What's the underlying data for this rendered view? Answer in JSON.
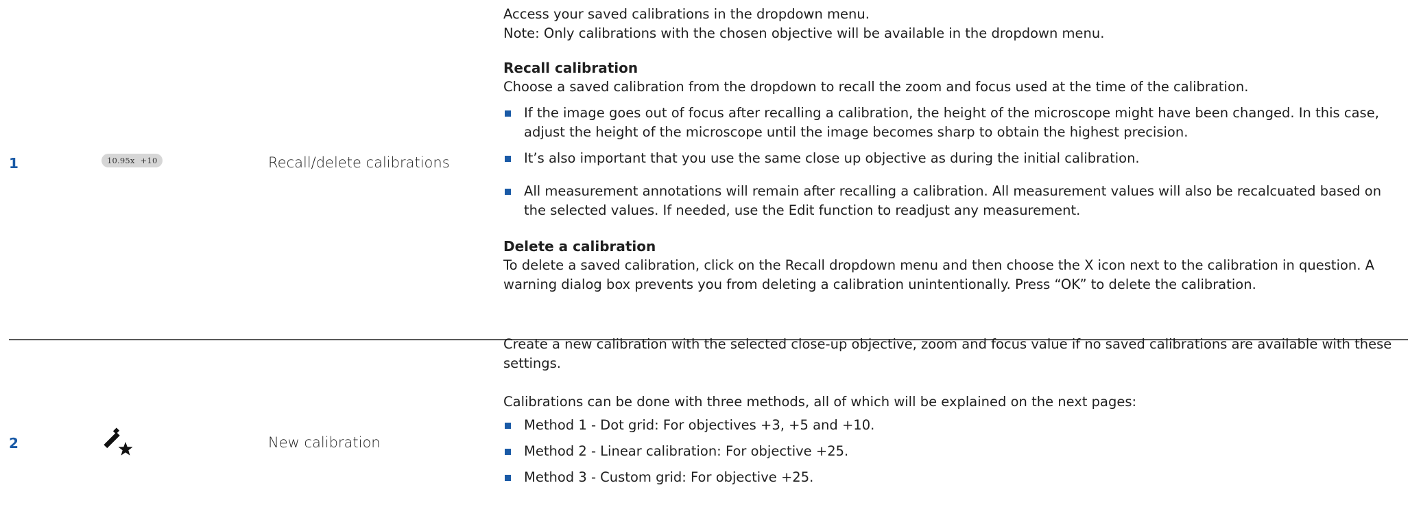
{
  "rows": [
    {
      "number": "1",
      "icon": {
        "name": "zoom-objective-pill",
        "zoom": "10.95x",
        "objective": "+10"
      },
      "function": "Recall/delete calibrations",
      "intro": [
        "Access your saved calibrations in the dropdown menu.",
        "Note: Only calibrations with the chosen objective will be available in the dropdown menu."
      ],
      "recall_heading": "Recall calibration",
      "recall_text": "Choose a saved calibration from the dropdown to recall the zoom and focus used at the time of the calibration.",
      "recall_bullets": [
        "If the image goes out of focus after recalling a calibration, the height of the microscope might have been changed. In this case, adjust the height of the microscope until the image becomes sharp to obtain the highest precision.",
        "It’s also important that you use the same close up objective as during the initial calibration.",
        "All measurement annotations will remain after recalling a calibration. All measurement values will also be recalcuated based on the selected values. If needed, use the Edit function to readjust any measurement."
      ],
      "delete_heading": "Delete a calibration",
      "delete_text": "To delete a saved calibration, click on the Recall dropdown menu  and then choose the X icon next to the calibration in question. A warning dialog box prevents you from deleting a calibration unintentionally. Press “OK” to delete the calibration."
    },
    {
      "number": "2",
      "icon": {
        "name": "magic-wand-star-icon"
      },
      "function": "New calibration",
      "intro": "Create a new calibration with the selected close-up objective, zoom and focus value if no saved calibrations are available with these settings.",
      "methods_intro": "Calibrations can be done with three methods, all of which will be explained on the next pages:",
      "methods": [
        "Method 1 - Dot grid: For objectives +3, +5 and +10.",
        "Method 2 - Linear calibration: For objective +25.",
        "Method 3 - Custom grid: For objective +25."
      ]
    }
  ],
  "colors": {
    "accent": "#1a5aa6",
    "divider": "#595959",
    "pill_bg": "#d6d6d6"
  }
}
